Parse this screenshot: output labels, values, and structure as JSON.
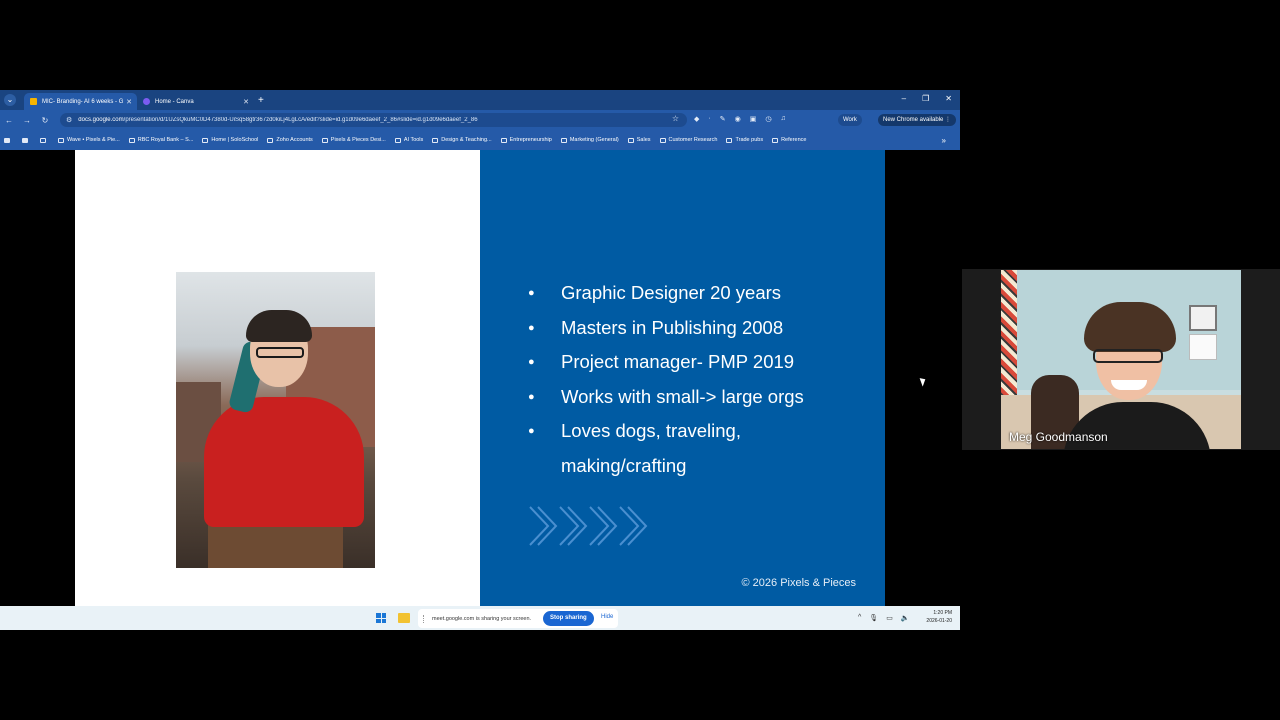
{
  "browser": {
    "tabs": [
      {
        "label": "MIC- Branding- AI 6 weeks - G",
        "favicon_color": "#f6b400",
        "active": true
      },
      {
        "label": "Home - Canva",
        "favicon_color": "#7c5cf0",
        "active": false
      }
    ],
    "url_host": "docs.google.com",
    "url_path": "/presentation/d/1UZsQkuMC0D47380d-UiSq58gtr367zd0kiLj4LgLcA/edit?slide=id.g1d09e6daeef_2_86#slide=id.g1d09e6daeef_2_86",
    "profile_label": "Work",
    "update_label": "New Chrome available",
    "bookmarks": [
      {
        "label": "Wave • Pixels & Pie...",
        "icon": "bookmark-page-icon"
      },
      {
        "label": "RBC Royal Bank – S...",
        "icon": "bookmark-page-icon"
      },
      {
        "label": "Home | SoloSchool",
        "icon": "bookmark-page-icon"
      },
      {
        "label": "Zoho Accounts",
        "icon": "bookmark-page-icon"
      },
      {
        "label": "Pixels & Pieces Desi...",
        "icon": "bookmark-page-icon"
      },
      {
        "label": "AI Tools",
        "icon": "folder-icon"
      },
      {
        "label": "Design & Teaching...",
        "icon": "folder-icon"
      },
      {
        "label": "Entrepreneurship",
        "icon": "folder-icon"
      },
      {
        "label": "Marketing (General)",
        "icon": "folder-icon"
      },
      {
        "label": "Sales",
        "icon": "folder-icon"
      },
      {
        "label": "Customer Research",
        "icon": "folder-icon"
      },
      {
        "label": "Trade pubs",
        "icon": "folder-icon"
      },
      {
        "label": "Reference",
        "icon": "folder-icon"
      }
    ]
  },
  "slide": {
    "bullets": [
      "Graphic Designer 20 years",
      "Masters in Publishing 2008",
      "Project manager- PMP 2019",
      "Works with small-> large orgs",
      "Loves dogs, traveling,",
      "making/crafting"
    ],
    "credit": "© 2026 Pixels & Pieces",
    "colors": {
      "panel": "#005ba3",
      "left": "#ffffff",
      "chevron": "#4a8fd0"
    }
  },
  "taskbar": {
    "share_text": "meet.google.com is sharing your screen.",
    "stop_label": "Stop sharing",
    "hide_label": "Hide",
    "time": "1:20 PM",
    "date": "2026-01-20"
  },
  "participant": {
    "name": "Meg Goodmanson"
  }
}
